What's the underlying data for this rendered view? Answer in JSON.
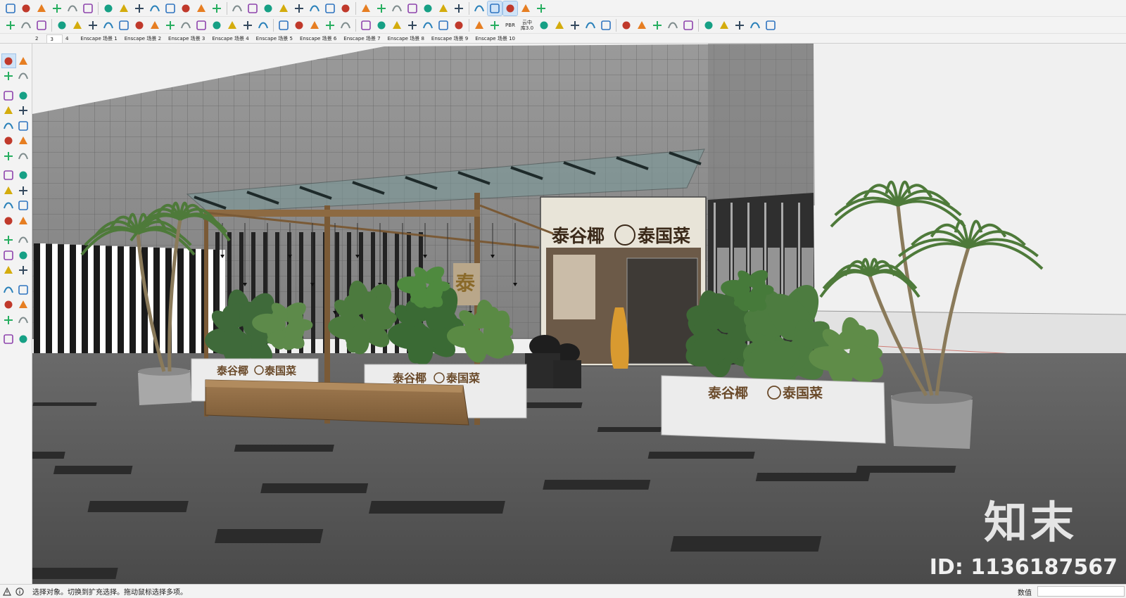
{
  "toolbar": {
    "row1_icons": [
      "open-folder-icon",
      "save-icon",
      "model-info-icon",
      "components-icon",
      "export-icon",
      "import-icon",
      "select-tool-icon",
      "rectangle-tool-icon",
      "paint-bucket-icon",
      "zoom-icon",
      "freehand-icon",
      "line-tool-icon",
      "dimension-icon",
      "protractor-icon",
      "scale-icon",
      "layer-icon",
      "section-plane-icon",
      "push-pull-icon",
      "move-icon",
      "rotate-icon",
      "offset-icon",
      "arc-icon",
      "orbit-icon",
      "pan-icon",
      "tape-measure-icon",
      "view-icon",
      "enscape-render-icon",
      "enscape-sync-icon",
      "enscape-settings-icon",
      "enscape-asset-icon",
      "axes-icon",
      "texture-icon",
      "globe-icon",
      "geo-icon"
    ],
    "row2_icons": [
      "pencil-icon",
      "dimensions-icon",
      "walk-icon",
      "erase-icon",
      "group-icon",
      "solid-icon",
      "trim-icon",
      "outer-shell-icon",
      "subtract-icon",
      "intersect-icon",
      "union-icon",
      "add-location-icon",
      "tree-icon",
      "fog-icon",
      "checker-icon",
      "cloud-upload-icon",
      "gear-icon",
      "mail-icon",
      "info-icon",
      "list-icon",
      "bulb-icon",
      "contrast-icon",
      "square-icon",
      "fit-icon",
      "hexagon-icon",
      "hexagon-outline-icon",
      "point-icon",
      "grid-icon",
      "delete-icon",
      "cube-icon",
      "material-icon",
      "pbr-icon",
      "cloud-library-icon",
      "select-pointer-icon",
      "gold-material-icon",
      "axis-move-icon",
      "mountain-icon",
      "person-icon",
      "package-icon",
      "link-cloud-icon",
      "cloud-search-icon",
      "cloud-icon",
      "cloud-sync-icon",
      "export-2d-icon",
      "refresh-badge-icon",
      "render-settings-icon",
      "layout-icon",
      "scene-export-icon"
    ],
    "pbr_label": "PBR",
    "cloud_label_top": "云中",
    "cloud_label_bottom": "库3.0"
  },
  "scene_tabs": [
    {
      "label": "2"
    },
    {
      "label": "3"
    },
    {
      "label": "4"
    },
    {
      "label": "Enscape 场景 1"
    },
    {
      "label": "Enscape 场景 2"
    },
    {
      "label": "Enscape 场景 3"
    },
    {
      "label": "Enscape 场景 4"
    },
    {
      "label": "Enscape 场景 5"
    },
    {
      "label": "Enscape 场景 6"
    },
    {
      "label": "Enscape 场景 7"
    },
    {
      "label": "Enscape 场景 8"
    },
    {
      "label": "Enscape 场景 9"
    },
    {
      "label": "Enscape 场景 10"
    }
  ],
  "left_toolbar": {
    "icons": [
      "select-arrow-icon",
      "component-make-icon",
      "paint-icon",
      "eraser-icon",
      "line-pencil-icon",
      "freehand-curve-icon",
      "rectangle-icon",
      "rotated-rectangle-icon",
      "circle-icon",
      "polygon-icon",
      "arc-icon",
      "arc-2point-icon",
      "arc-3point-icon",
      "pie-icon",
      "move-arrows-icon",
      "push-pull-icon",
      "rotate-icon",
      "follow-me-icon",
      "scale-icon",
      "offset-icon",
      "tape-measure-icon",
      "dimension-icon",
      "protractor-icon",
      "text-label-icon",
      "axes-icon",
      "3d-text-icon",
      "orbit-icon",
      "pan-hand-icon",
      "zoom-magnifier-icon",
      "zoom-window-icon",
      "zoom-extents-icon",
      "previous-view-icon",
      "position-camera-icon",
      "look-around-icon",
      "walk-footprints-icon",
      "section-plane-icon"
    ]
  },
  "viewport": {
    "signage": {
      "storefront": "泰谷椰",
      "storefront_suffix": "泰国菜",
      "planter_left": "泰谷椰",
      "planter_left_suffix": "泰国菜",
      "planter_mid": "泰谷椰",
      "planter_mid_suffix": "泰国菜",
      "planter_right": "泰谷椰",
      "planter_right_suffix": "泰国菜",
      "column_glyph": "泰"
    },
    "watermark_logo": "知末",
    "watermark_id": "ID: 1136187567",
    "colors": {
      "sky": "#f0f0f0",
      "facade": "#8a8a8a",
      "ground": "#4e4e4e",
      "planter": "#eeeeee",
      "wood": "#8a6a44",
      "sign_text": "#6a4a2a"
    }
  },
  "statusbar": {
    "text": "选择对象。切换到扩充选择。拖动鼠标选择多项。",
    "measure_label": "数值",
    "measure_value": ""
  }
}
